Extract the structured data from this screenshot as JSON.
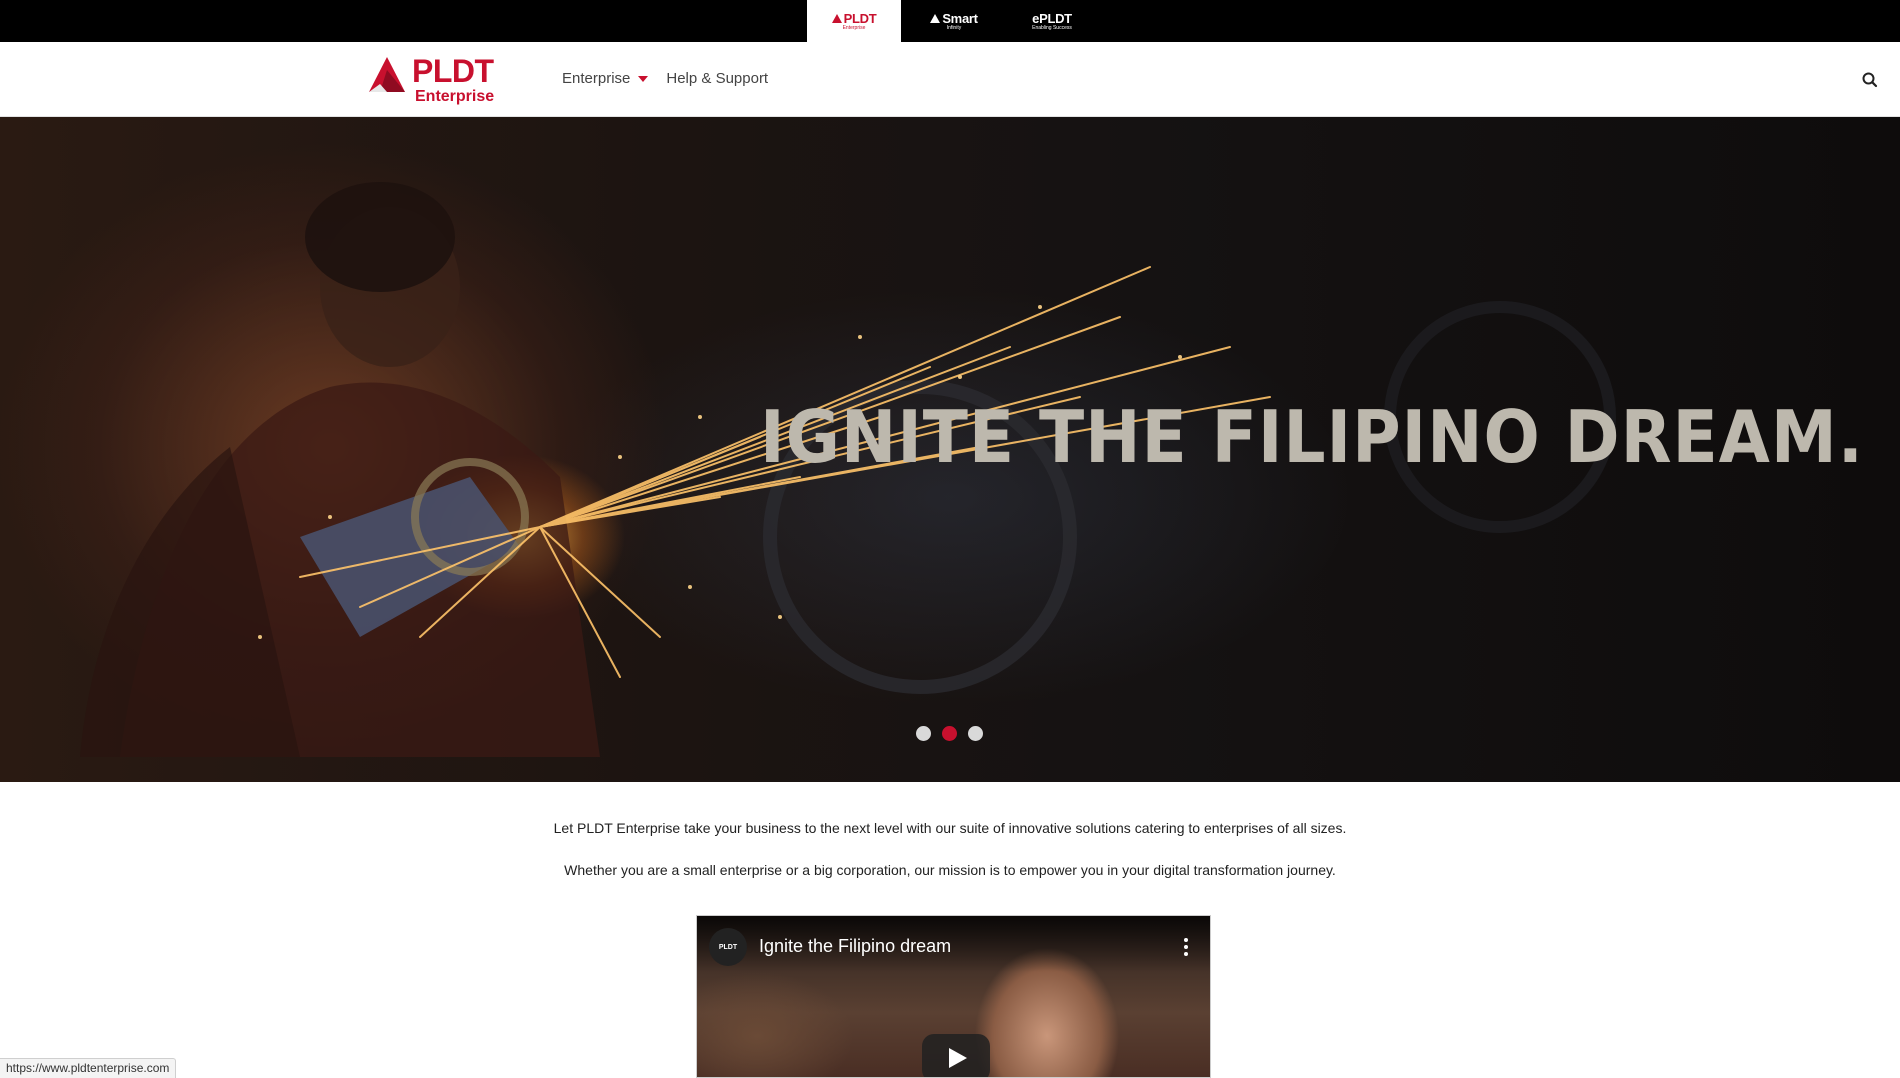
{
  "brand_bar": {
    "tabs": [
      {
        "name": "PLDT",
        "sub": "Enterprise",
        "active": true
      },
      {
        "name": "Smart",
        "sub": "Infinity",
        "active": false
      },
      {
        "name": "ePLDT",
        "sub": "Enabling Success",
        "active": false
      }
    ]
  },
  "header": {
    "logo_word": "PLDT",
    "logo_sub": "Enterprise",
    "nav": {
      "enterprise": "Enterprise",
      "help": "Help & Support"
    },
    "icons": {
      "search": "search-icon",
      "dropdown": "caret-down-icon"
    }
  },
  "hero": {
    "headline": "IGNITE THE FILIPINO DREAM.",
    "slides_count": 3,
    "active_slide": 2
  },
  "intro": {
    "line1": "Let PLDT Enterprise take your business to the next level with our suite of innovative solutions catering to enterprises of all sizes.",
    "line2": "Whether you are a small enterprise or a big corporation, our mission is to empower you in your digital transformation journey."
  },
  "video": {
    "title": "Ignite the Filipino dream",
    "channel": "PLDT"
  },
  "status_bar": {
    "url": "https://www.pldtenterprise.com"
  },
  "colors": {
    "brand_red": "#c8102e",
    "topbar": "#000000",
    "headline": "#bdb8ad"
  }
}
